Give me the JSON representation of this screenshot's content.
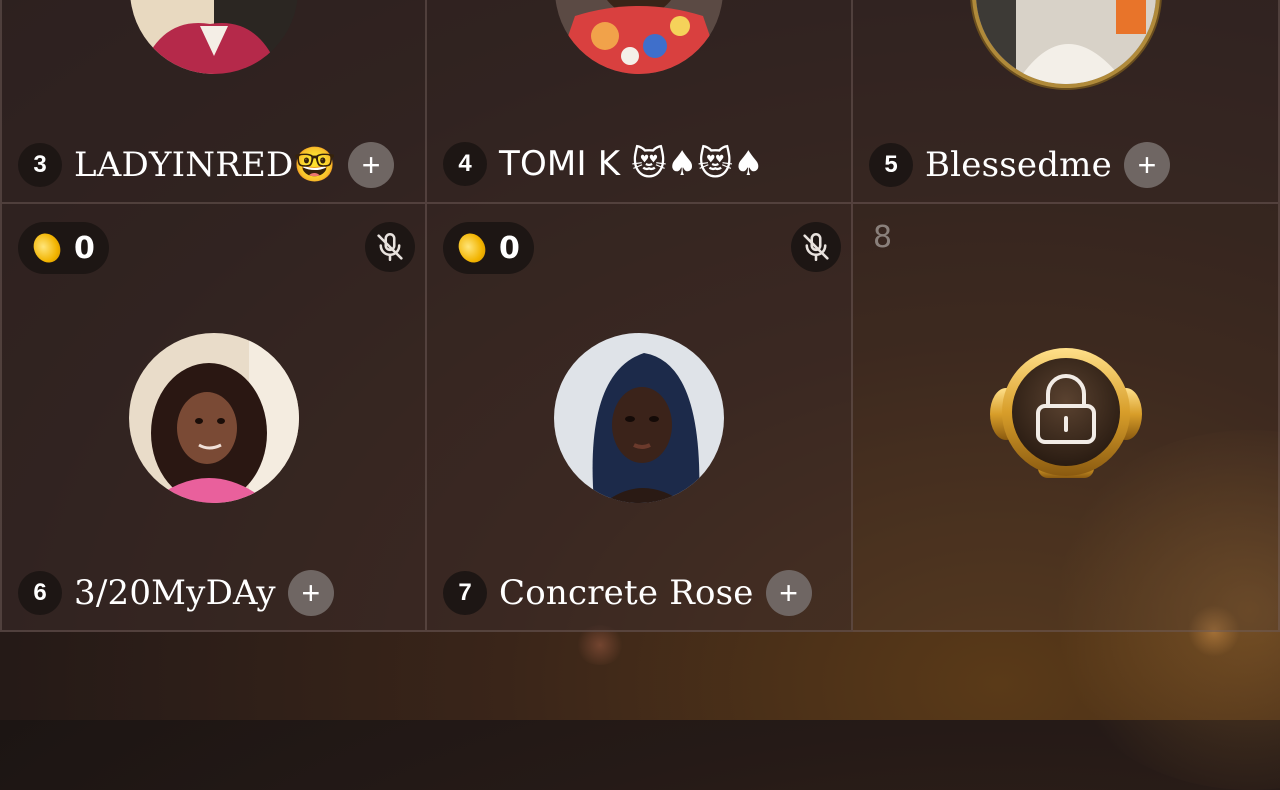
{
  "seats": [
    {
      "number": "3",
      "name": "LADYINRED🤓",
      "follow_label": "+"
    },
    {
      "number": "4",
      "name": "TOMI K 😻♠😻♠",
      "follow_label": "+"
    },
    {
      "number": "5",
      "name": "Blessedme",
      "follow_label": "+"
    },
    {
      "number": "6",
      "name": "3/20MyDAy",
      "follow_label": "+",
      "coins": "0",
      "muted": true
    },
    {
      "number": "7",
      "name": "Concrete Rose",
      "follow_label": "+",
      "coins": "0",
      "muted": true
    },
    {
      "number": "8",
      "locked": true
    }
  ],
  "icons": {
    "coin": "coin-icon",
    "mute": "mic-off-icon",
    "lock": "lock-icon",
    "follow": "plus-icon"
  },
  "colors": {
    "background": "#251a17",
    "seat_badge": "#1d1614",
    "follow_button": "#6f6663",
    "gold": "#d4a437"
  }
}
